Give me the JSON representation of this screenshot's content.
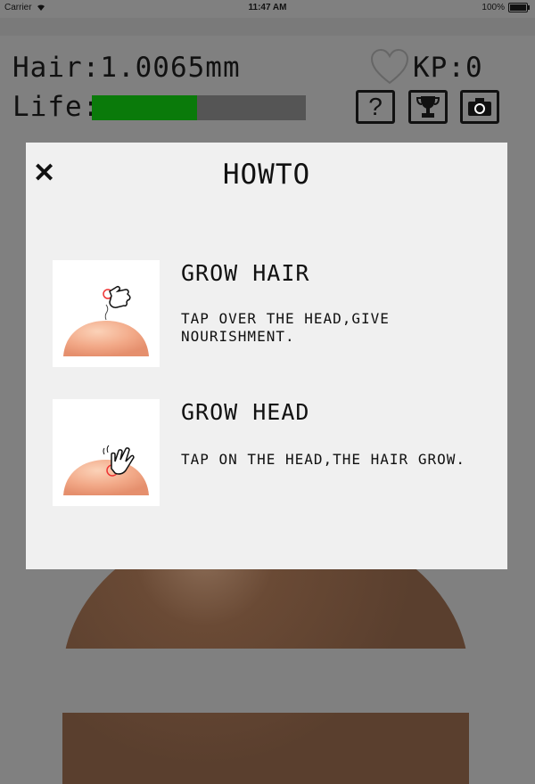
{
  "status_bar": {
    "carrier": "Carrier",
    "time": "11:47 AM",
    "battery": "100%"
  },
  "hud": {
    "hair_readout": "Hair:1.0065mm",
    "life_label": "Life:",
    "life_level": 0.49,
    "kp_readout": "KP:0",
    "life_color": "#0a7a0a"
  },
  "toolbar": {
    "icons": [
      "question-icon",
      "trophy-icon",
      "camera-icon"
    ]
  },
  "modal": {
    "title": "HOWTO",
    "close_icon": "close-icon",
    "tips": [
      {
        "title": "GROW HAIR",
        "description": "TAP OVER THE HEAD,GIVE NOURISHMENT."
      },
      {
        "title": "GROW HEAD",
        "description": "TAP ON THE HEAD,THE HAIR GROW."
      }
    ]
  }
}
